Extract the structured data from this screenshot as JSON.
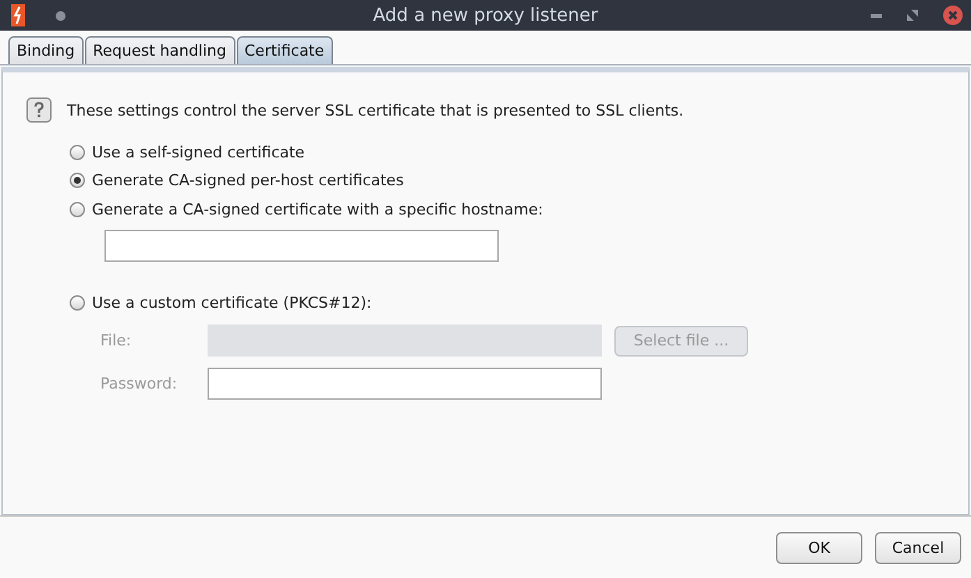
{
  "window": {
    "title": "Add a new proxy listener"
  },
  "tabs": [
    {
      "label": "Binding",
      "selected": false
    },
    {
      "label": "Request handling",
      "selected": false
    },
    {
      "label": "Certificate",
      "selected": true
    }
  ],
  "description": "These settings control the server SSL certificate that is presented to SSL clients.",
  "options": [
    {
      "label": "Use a self-signed certificate",
      "selected": false
    },
    {
      "label": "Generate CA-signed per-host certificates",
      "selected": true
    },
    {
      "label": "Generate a CA-signed certificate with a specific hostname:",
      "selected": false,
      "field": {
        "disabled": false
      }
    }
  ],
  "custom": {
    "label": "Use a custom certificate (PKCS#12):",
    "selected": false,
    "file": {
      "label": "File:",
      "disabled": true
    },
    "select_button": {
      "label": "Select file ...",
      "disabled": true
    },
    "password": {
      "label": "Password:",
      "disabled": false
    }
  },
  "buttons": [
    "OK",
    "Cancel"
  ]
}
